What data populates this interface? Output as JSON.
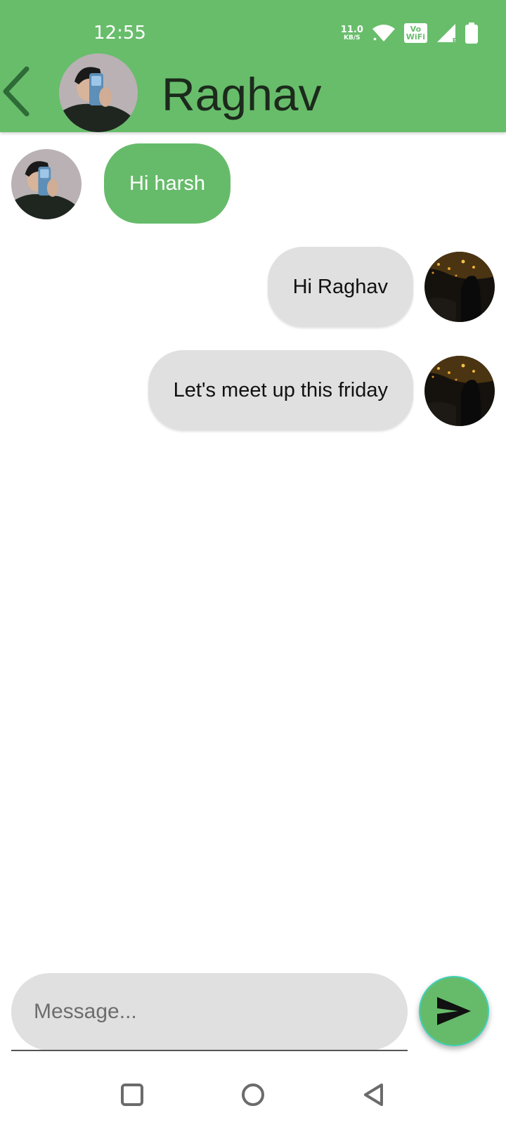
{
  "status_bar": {
    "time": "12:55",
    "net_speed_value": "11.0",
    "net_speed_unit": "KB/S",
    "vowifi_line1": "Vo",
    "vowifi_line2": "WiFi",
    "signal_label": "R",
    "text_color": "#ffffff"
  },
  "header": {
    "contact_name": "Raghav",
    "back_icon": "chevron-left-icon",
    "background_color": "#68bd6b"
  },
  "messages": [
    {
      "direction": "received",
      "text": "Hi harsh",
      "bubble_color": "#66bb6a"
    },
    {
      "direction": "sent",
      "text": "Hi Raghav",
      "bubble_color": "#e0e0e0"
    },
    {
      "direction": "sent",
      "text": "Let's meet up this friday",
      "bubble_color": "#e0e0e0"
    }
  ],
  "composer": {
    "placeholder": "Message...",
    "value": "",
    "send_icon": "send-icon",
    "send_button_color": "#66bb6a"
  },
  "nav_bar": {
    "icons": [
      "recents-square-icon",
      "home-circle-icon",
      "back-triangle-icon"
    ]
  }
}
